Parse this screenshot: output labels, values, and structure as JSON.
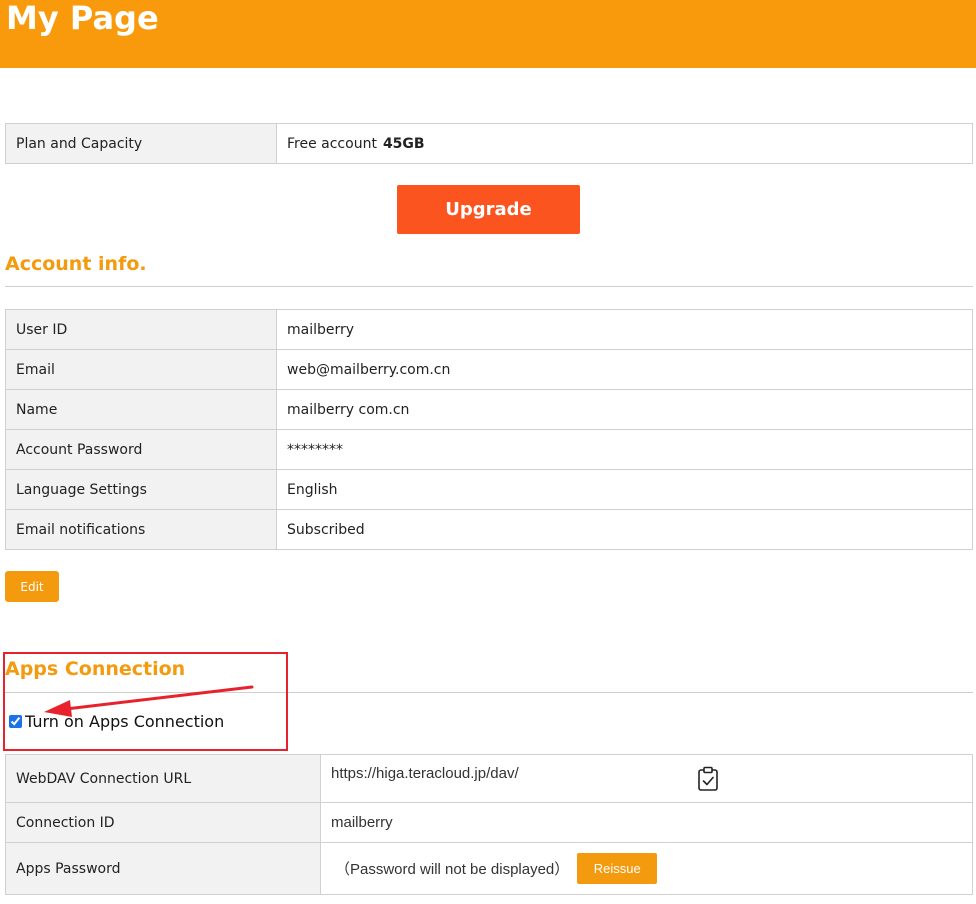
{
  "header": {
    "title": "My Page"
  },
  "plan": {
    "label": "Plan and Capacity",
    "account_type": "Free account",
    "capacity": "45GB",
    "upgrade_label": "Upgrade"
  },
  "account": {
    "title": "Account info.",
    "rows": [
      {
        "label": "User ID",
        "value": "mailberry"
      },
      {
        "label": "Email",
        "value": "web@mailberry.com.cn"
      },
      {
        "label": "Name",
        "value": "mailberry com.cn"
      },
      {
        "label": "Account Password",
        "value": "********"
      },
      {
        "label": "Language Settings",
        "value": "English"
      },
      {
        "label": "Email notifications",
        "value": "Subscribed"
      }
    ],
    "edit_label": "Edit"
  },
  "apps": {
    "title": "Apps Connection",
    "toggle_label": "Turn on Apps Connection",
    "toggle_checked": true,
    "webdav_label": "WebDAV Connection URL",
    "webdav_url": "https://higa.teracloud.jp/dav/",
    "connection_id_label": "Connection ID",
    "connection_id": "mailberry",
    "password_label": "Apps Password",
    "password_note": "（Password will not be displayed）",
    "reissue_label": "Reissue"
  },
  "colors": {
    "header": "#f99a0c",
    "accent": "#f39a0e",
    "upgrade": "#fb541e",
    "annotation": "#e8222c"
  }
}
